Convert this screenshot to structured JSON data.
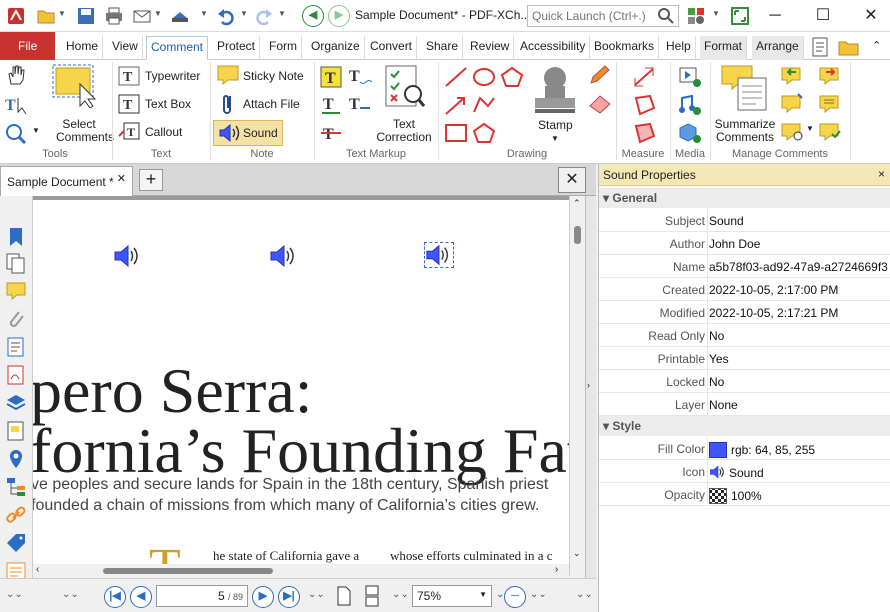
{
  "window": {
    "title": "Sample Document* - PDF-XCh...",
    "quick_launch_placeholder": "Quick Launch (Ctrl+.)"
  },
  "ribbon_tabs": [
    "File",
    "Home",
    "View",
    "Comment",
    "Protect",
    "Form",
    "Organize",
    "Convert",
    "Share",
    "Review",
    "Accessibility",
    "Bookmarks",
    "Help",
    "Format",
    "Arrange"
  ],
  "ribbon": {
    "tools": {
      "select_comments": "Select Comments",
      "label": "Tools"
    },
    "text": {
      "typewriter": "Typewriter",
      "text_box": "Text Box",
      "callout": "Callout",
      "label": "Text"
    },
    "note": {
      "sticky_note": "Sticky Note",
      "attach_file": "Attach File",
      "sound": "Sound",
      "label": "Note"
    },
    "text_markup": {
      "text_correction": "Text Correction",
      "label": "Text Markup"
    },
    "drawing": {
      "stamp": "Stamp",
      "label": "Drawing"
    },
    "measure": {
      "label": "Measure"
    },
    "media": {
      "label": "Media"
    },
    "manage": {
      "summarize_comments": "Summarize Comments",
      "label": "Manage Comments"
    }
  },
  "document_tab": {
    "title": "Sample Document *"
  },
  "page": {
    "title_line1": "pero Serra:",
    "title_line2": "fornia’s Founding Fathe",
    "subtitle_line1": "ve peoples and secure lands for Spain in the 18th century, Spanish priest",
    "subtitle_line2": "founded a chain of missions from which many of California’s cities grew.",
    "drop_cap": "T",
    "column1": "he state of California gave a",
    "column2": "whose efforts culminated in a c"
  },
  "status": {
    "page_value": "5",
    "page_total": "/ 89",
    "zoom": "75%"
  },
  "properties": {
    "header": "Sound Properties",
    "general_label": "General",
    "general": [
      {
        "key": "Subject",
        "value": "Sound"
      },
      {
        "key": "Author",
        "value": "John Doe"
      },
      {
        "key": "Name",
        "value": "a5b78f03-ad92-47a9-a2724669f3..."
      },
      {
        "key": "Created",
        "value": "2022-10-05, 2:17:00 PM"
      },
      {
        "key": "Modified",
        "value": "2022-10-05, 2:17:21 PM"
      },
      {
        "key": "Read Only",
        "value": "No"
      },
      {
        "key": "Printable",
        "value": "Yes"
      },
      {
        "key": "Locked",
        "value": "No"
      },
      {
        "key": "Layer",
        "value": "None"
      }
    ],
    "style_label": "Style",
    "style": [
      {
        "key": "Fill Color",
        "value": "rgb: 64, 85, 255"
      },
      {
        "key": "Icon",
        "value": "Sound"
      },
      {
        "key": "Opacity",
        "value": "100%"
      }
    ]
  },
  "colors": {
    "accent": "#c8332f",
    "fill_color": "#4055ff",
    "panel_header": "#f3e7b6"
  }
}
